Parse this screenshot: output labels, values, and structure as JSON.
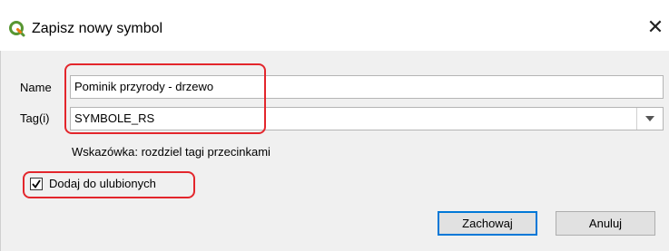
{
  "window": {
    "title": "Zapisz nowy symbol",
    "app_icon": "qgis-icon",
    "close_glyph": "✕"
  },
  "form": {
    "name_label": "Name",
    "name_value": "Pominik przyrody - drzewo",
    "tags_label": "Tag(i)",
    "tags_value": "SYMBOLE_RS",
    "hint": "Wskazówka: rozdziel tagi przecinkami",
    "favorite_label": "Dodaj do ulubionych",
    "favorite_checked": true
  },
  "buttons": {
    "save": "Zachowaj",
    "cancel": "Anuluj"
  },
  "colors": {
    "highlight": "#e3262c",
    "default_button_border": "#0078d7",
    "qgis_green": "#589632",
    "qgis_yellow": "#ee7913"
  }
}
